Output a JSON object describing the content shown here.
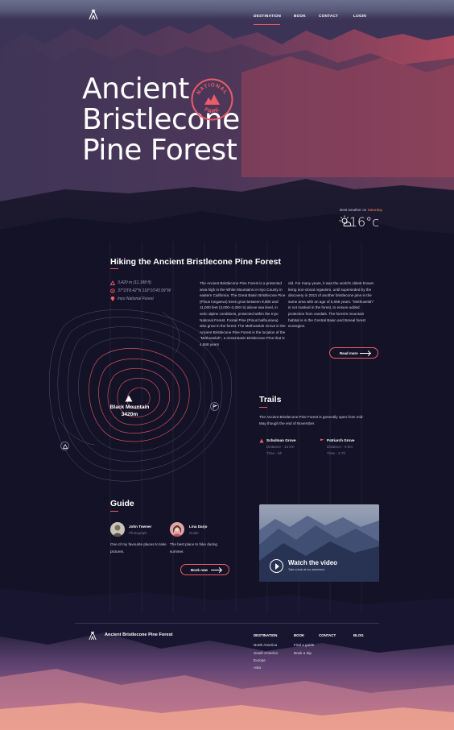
{
  "nav": {
    "items": [
      "DESTINATION",
      "BOOK",
      "CONTACT",
      "LOGIN"
    ],
    "active": "DESTINATION"
  },
  "hero": {
    "title": "Ancient Bristlecone Pine Forest",
    "badge_top": "NATIONAL",
    "badge_bottom": "PARK"
  },
  "weather": {
    "label": "Best weather on",
    "day": "Saturday",
    "temperature": "16°c",
    "icon": "partly-cloudy-icon"
  },
  "hiking": {
    "title": "Hiking the Ancient Bristlecone Pine Forest",
    "facts": [
      {
        "icon": "elevation-icon",
        "text": "3,420 m (11,188 ft)"
      },
      {
        "icon": "coordinates-icon",
        "text": "37°23'8.42\"N 118°10'43.99\"W"
      },
      {
        "icon": "location-pin-icon",
        "text": "Inyo National Forest"
      }
    ],
    "paragraph_left": "The Ancient Bristlecone Pine Forest is a protected area high in the White Mountains in Inyo County in eastern California. The Great Basin Bristlecone Pine (Pinus longaeva) trees grow between 9,800 and 11,000 feet (3,000–3,400 m) above sea level, in xeric alpine conditions, protected within the Inyo National Forest. Foxtail Pine (Pinus balfouriana) also grow in the forest. The Methuselah Grove in the Ancient Bristlecone Pine Forest is the location of the \"Methuselah\", a Great Basin Bristlecone Pine that is 4,848 years",
    "paragraph_right": "old. For many years, it was the world's oldest known living non-clonal organism, until superseded by the discovery in 2013 of another bristlecone pine in the same area with an age of 5,066 years. \"Methuselah\" is not marked in the forest, to ensure added protection from vandals. The forest's mountain habitat is in the Central Basin and Boreal forest ecoregion.",
    "read_more": "Read more"
  },
  "map": {
    "peak_name": "Black Mountain",
    "peak_height": "3420m"
  },
  "trails": {
    "title": "Trails",
    "description": "The Ancient Bristlecone Pine Forest is generally open from mid-May though the end of November.",
    "items": [
      {
        "name": "Schulman Grove",
        "distance": "Distance - 13 km",
        "time": "Time - 5h"
      },
      {
        "name": "Patriarch Grove",
        "distance": "Distance - 9 km",
        "time": "Time - 3.7h"
      }
    ]
  },
  "guide": {
    "title": "Guide",
    "people": [
      {
        "name": "John Towner",
        "role": "Photograph",
        "quote": "One of my favourite places to take pictures."
      },
      {
        "name": "Lina Darjo",
        "role": "Guide",
        "quote": "The best place to hike during summer."
      }
    ],
    "book_now": "Book now"
  },
  "video": {
    "title": "Watch the video",
    "subtitle": "Take a look at our adventure"
  },
  "footer": {
    "brand": "Ancient Bristlecone Pine Forest",
    "columns": [
      {
        "heading": "DESTINATION",
        "links": [
          "North America",
          "South America",
          "Europe",
          "Asia"
        ]
      },
      {
        "heading": "BOOK",
        "links": [
          "Find a guide",
          "Book a trip"
        ]
      },
      {
        "heading": "CONTACT",
        "links": []
      },
      {
        "heading": "BLOG",
        "links": []
      }
    ]
  },
  "colors": {
    "accent": "#ec5c66",
    "background": "#141226",
    "weather_day": "#f08a5b"
  }
}
